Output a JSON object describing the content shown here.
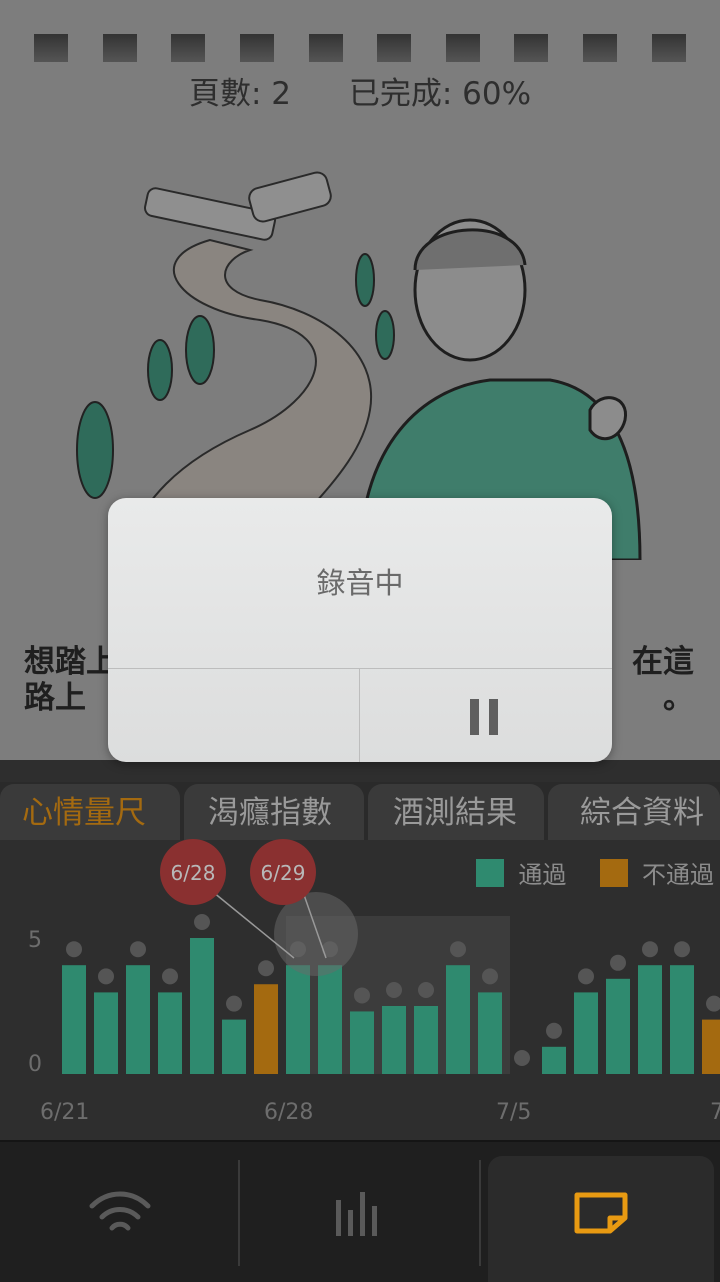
{
  "page": {
    "page_number_text": "頁數: 2",
    "completion_text": "已完成: 60%",
    "story_left_line1": "想踏上",
    "story_left_line2": "路上",
    "story_right_line1": "在這",
    "story_right_line2": "。"
  },
  "dialog": {
    "message": "錄音中",
    "pause_icon": "pause-icon"
  },
  "tabs": [
    {
      "label": "心情量尺",
      "active": true
    },
    {
      "label": "渴癮指數",
      "active": false
    },
    {
      "label": "酒測結果",
      "active": false
    },
    {
      "label": "綜合資料",
      "active": false
    }
  ],
  "legend": {
    "pass_label": "通過",
    "fail_label": "不通過",
    "pass_color": "#2f8a6f",
    "fail_color": "#a46a10"
  },
  "chart_data": {
    "type": "bar",
    "ylim": [
      0,
      6
    ],
    "y_ticks": [
      "5",
      "0"
    ],
    "x_tick_labels": [
      "6/21",
      "6/28",
      "7/5",
      "7"
    ],
    "categories": [
      "6/21",
      "6/22",
      "6/23",
      "6/24",
      "6/25",
      "6/26",
      "6/27",
      "6/28",
      "6/29",
      "6/30",
      "7/1",
      "7/2",
      "7/3",
      "7/4",
      "7/5",
      "7/6",
      "7/7",
      "7/8",
      "7/9",
      "7/10",
      "7/11"
    ],
    "values": [
      4,
      3,
      4,
      3,
      5,
      2,
      3.3,
      4,
      4,
      2.3,
      2.5,
      2.5,
      4,
      3,
      0,
      1,
      3,
      3.5,
      4,
      4,
      2
    ],
    "status": [
      "pass",
      "pass",
      "pass",
      "pass",
      "pass",
      "pass",
      "fail",
      "pass",
      "pass",
      "pass",
      "pass",
      "pass",
      "pass",
      "pass",
      "none",
      "pass",
      "pass",
      "pass",
      "pass",
      "pass",
      "fail"
    ],
    "callouts": [
      {
        "label": "6/28",
        "category": "6/28"
      },
      {
        "label": "6/29",
        "category": "6/29"
      }
    ]
  },
  "navbar": {
    "items": [
      {
        "icon": "wifi-icon"
      },
      {
        "icon": "bar-chart-icon"
      },
      {
        "icon": "note-icon",
        "active": true
      }
    ],
    "active_color": "#e89a12"
  }
}
